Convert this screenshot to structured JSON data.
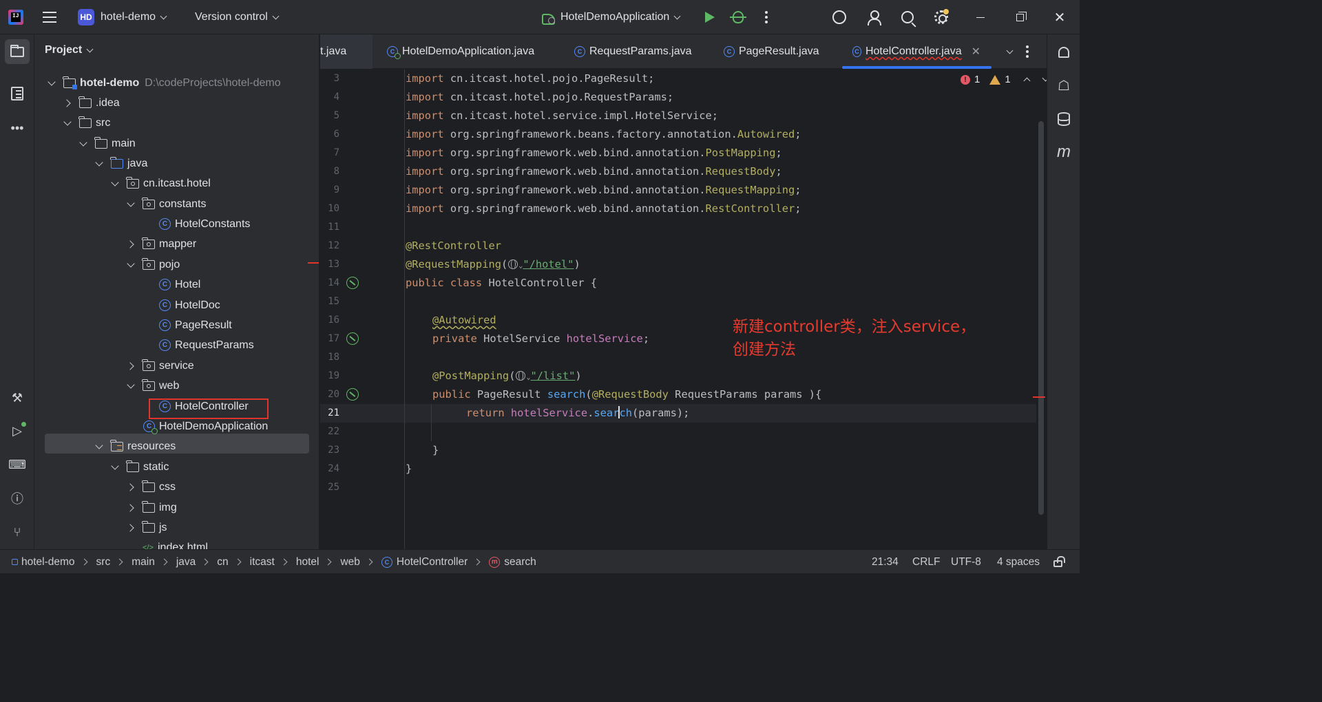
{
  "titlebar": {
    "app_icon_text": "IJ",
    "project_badge": "HD",
    "project_name": "hotel-demo",
    "version_control": "Version control",
    "run_config": "HotelDemoApplication"
  },
  "project_panel": {
    "title": "Project",
    "tree": [
      {
        "label": "hotel-demo",
        "extra": "D:\\codeProjects\\hotel-demo",
        "icon": "module-folder-icon",
        "expanded": true
      },
      {
        "label": ".idea",
        "icon": "folder-icon",
        "expanded": false
      },
      {
        "label": "src",
        "icon": "folder-icon",
        "expanded": true
      },
      {
        "label": "main",
        "icon": "folder-icon",
        "expanded": true
      },
      {
        "label": "java",
        "icon": "source-folder-icon",
        "expanded": true
      },
      {
        "label": "cn.itcast.hotel",
        "icon": "package-icon",
        "expanded": true
      },
      {
        "label": "constants",
        "icon": "package-icon",
        "expanded": true
      },
      {
        "label": "HotelConstants",
        "icon": "class-icon"
      },
      {
        "label": "mapper",
        "icon": "package-icon",
        "expanded": false
      },
      {
        "label": "pojo",
        "icon": "package-icon",
        "expanded": true
      },
      {
        "label": "Hotel",
        "icon": "class-icon"
      },
      {
        "label": "HotelDoc",
        "icon": "class-icon"
      },
      {
        "label": "PageResult",
        "icon": "class-icon"
      },
      {
        "label": "RequestParams",
        "icon": "class-icon"
      },
      {
        "label": "service",
        "icon": "package-icon",
        "expanded": false
      },
      {
        "label": "web",
        "icon": "package-icon",
        "expanded": true
      },
      {
        "label": "HotelController",
        "icon": "class-icon",
        "selected": true
      },
      {
        "label": "HotelDemoApplication",
        "icon": "spring-boot-class-icon"
      },
      {
        "label": "resources",
        "icon": "resources-folder-icon",
        "expanded": true
      },
      {
        "label": "static",
        "icon": "folder-icon",
        "expanded": true
      },
      {
        "label": "css",
        "icon": "folder-icon",
        "expanded": false
      },
      {
        "label": "img",
        "icon": "folder-icon",
        "expanded": false
      },
      {
        "label": "js",
        "icon": "folder-icon",
        "expanded": false
      },
      {
        "label": "index.html",
        "icon": "html-file-icon"
      }
    ]
  },
  "tabs": [
    {
      "label": "t.java"
    },
    {
      "label": "HotelDemoApplication.java"
    },
    {
      "label": "RequestParams.java"
    },
    {
      "label": "PageResult.java"
    },
    {
      "label": "HotelController.java",
      "active": true
    }
  ],
  "editor": {
    "inspections": {
      "errors": "1",
      "warnings": "1"
    },
    "current_line": 21,
    "lines": [
      {
        "n": "3"
      },
      {
        "n": "4"
      },
      {
        "n": "5"
      },
      {
        "n": "6"
      },
      {
        "n": "7"
      },
      {
        "n": "8"
      },
      {
        "n": "9"
      },
      {
        "n": "10"
      },
      {
        "n": "11"
      },
      {
        "n": "12"
      },
      {
        "n": "13"
      },
      {
        "n": "14"
      },
      {
        "n": "15"
      },
      {
        "n": "16"
      },
      {
        "n": "17"
      },
      {
        "n": "18"
      },
      {
        "n": "19"
      },
      {
        "n": "20"
      },
      {
        "n": "21"
      },
      {
        "n": "22"
      },
      {
        "n": "23"
      },
      {
        "n": "24"
      },
      {
        "n": "25"
      }
    ],
    "code": {
      "l3_pkg": "cn.itcast.hotel.pojo.PageResult;",
      "l4_pkg": "cn.itcast.hotel.pojo.RequestParams;",
      "l5_pkg": "cn.itcast.hotel.service.impl.HotelService;",
      "l6_pkg": "org.springframework.beans.factory.annotation.",
      "l6_cls": "Autowired",
      "l7_pkg": "org.springframework.web.bind.annotation.",
      "l7_cls": "PostMapping",
      "l8_pkg": "org.springframework.web.bind.annotation.",
      "l8_cls": "RequestBody",
      "l9_pkg": "org.springframework.web.bind.annotation.",
      "l9_cls": "RequestMapping",
      "l10_pkg": "org.springframework.web.bind.annotation.",
      "l10_cls": "RestController",
      "import_kw": "import",
      "semicolon": ";",
      "l12": "@RestController",
      "l13_ann": "@RequestMapping",
      "l13_str": "\"/hotel\"",
      "l14_kw": "public class",
      "l14_rest": " HotelController {",
      "l16": "@Autowired",
      "l17_kw": "private",
      "l17_type": " HotelService ",
      "l17_field": "hotelService",
      "l19_ann": "@PostMapping",
      "l19_str": "\"/list\"",
      "l20_kw": "public",
      "l20_type": " PageResult ",
      "l20_fn": "search",
      "l20_ann": "@RequestBody",
      "l20_rest": " RequestParams params ){",
      "l21_kw": "return",
      "l21_field": "hotelService",
      "l21_fn_a": "sear",
      "l21_fn_b": "ch",
      "l21_rest": "(params);",
      "l23": "}",
      "l24": "}"
    },
    "annotation_text": "新建controller类，注入service，\n创建方法"
  },
  "statusbar": {
    "breadcrumbs": [
      "hotel-demo",
      "src",
      "main",
      "java",
      "cn",
      "itcast",
      "hotel",
      "web",
      "HotelController",
      "search"
    ],
    "position": "21:34",
    "line_sep": "CRLF",
    "encoding": "UTF-8",
    "indent": "4 spaces"
  },
  "colors": {
    "accent": "#3574f0",
    "annotation_red": "#e53b2f",
    "keyword": "#cf8e6d",
    "annotation": "#b3ae60",
    "string": "#6aab73",
    "field": "#c77dbb",
    "function": "#56a8f5"
  }
}
